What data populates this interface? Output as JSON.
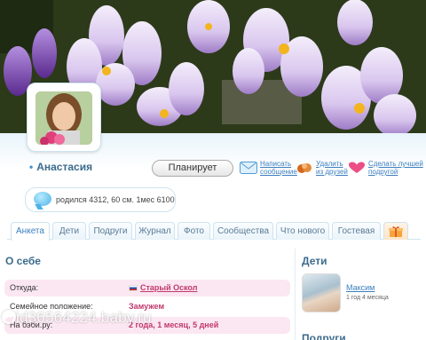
{
  "profile": {
    "name": "Анастасия",
    "plan_button": "Планирует",
    "status_text": "родился 4312, 60 см. 1мес 6100"
  },
  "actions": [
    {
      "label_line1": "Написать",
      "label_line2": "сообщение",
      "icon": "envelope-icon"
    },
    {
      "label_line1": "Удалить",
      "label_line2": "из друзей",
      "icon": "remove-friend-icon"
    },
    {
      "label_line1": "Сделать лучшей",
      "label_line2": "подругой",
      "icon": "heart-icon"
    }
  ],
  "tabs": [
    {
      "label": "Анкета"
    },
    {
      "label": "Дети"
    },
    {
      "label": "Подруги"
    },
    {
      "label": "Журнал"
    },
    {
      "label": "Фото"
    },
    {
      "label": "Сообщества"
    },
    {
      "label": "Что нового"
    },
    {
      "label": "Гостевая"
    }
  ],
  "about": {
    "title": "О себе",
    "rows": [
      {
        "key": "Откуда:",
        "value": "Старый Оскол"
      },
      {
        "key": "Семейное положение:",
        "value": "Замужем"
      },
      {
        "key": "На бэби.ру:",
        "value": "2 года, 1 месяц, 5 дней"
      }
    ]
  },
  "kids": {
    "title": "Дети",
    "child_name": "Максим",
    "child_age": "1 год 4 месяца"
  },
  "bottom_partial_title": "Подруги",
  "watermark": "id36564224.baby.ru",
  "colors": {
    "accent": "#3b7fbf",
    "pink": "#c0396b",
    "heading": "#3b6b8d"
  }
}
